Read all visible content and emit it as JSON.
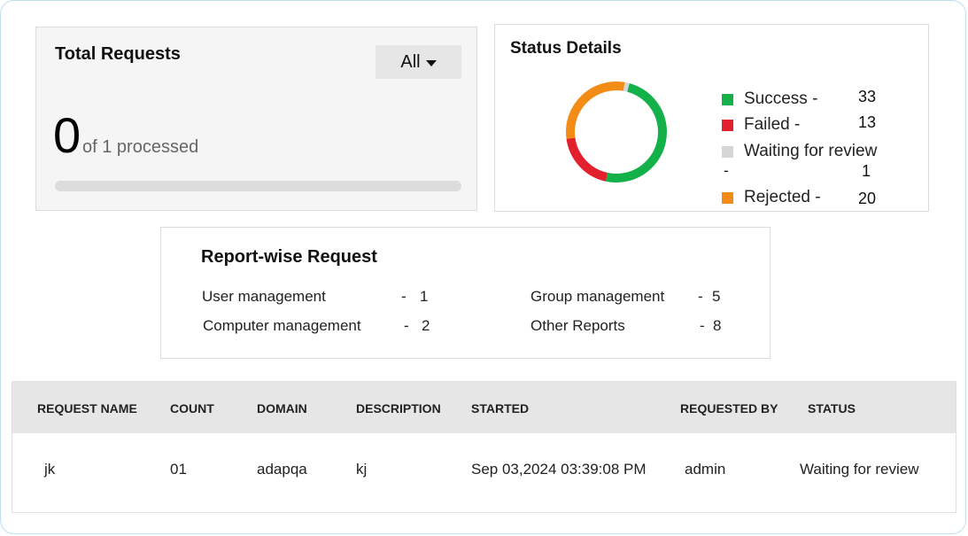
{
  "total_requests": {
    "title": "Total Requests",
    "filter_value": "All",
    "count": "0",
    "processed_text": "of 1 processed",
    "progress_fraction": 0.0
  },
  "status_details": {
    "title": "Status Details",
    "legend": [
      {
        "label": "Success -",
        "value": "33",
        "color": "#14b04a"
      },
      {
        "label": "Failed -",
        "value": "13",
        "color": "#e3202e"
      },
      {
        "label": "Waiting for review",
        "label_suffix": "-",
        "value": "1",
        "color": "#d6d6d6"
      },
      {
        "label": "Rejected -",
        "value": "20",
        "color": "#f28c16"
      }
    ]
  },
  "report_wise": {
    "title": "Report-wise Request",
    "items": [
      {
        "label": "User management",
        "sep": "-",
        "value": "1"
      },
      {
        "label": "Computer management",
        "sep": "-",
        "value": "2"
      },
      {
        "label": "Group management",
        "sep": "-",
        "value": "5"
      },
      {
        "label": "Other Reports",
        "sep": "-",
        "value": "8"
      }
    ]
  },
  "table": {
    "headers": [
      "REQUEST NAME",
      "COUNT",
      "DOMAIN",
      "DESCRIPTION",
      "STARTED",
      "REQUESTED BY",
      "STATUS"
    ],
    "rows": [
      [
        "jk",
        "01",
        "adapqa",
        "kj",
        "Sep 03,2024 03:39:08 PM",
        "admin",
        "Waiting for review"
      ]
    ]
  }
}
